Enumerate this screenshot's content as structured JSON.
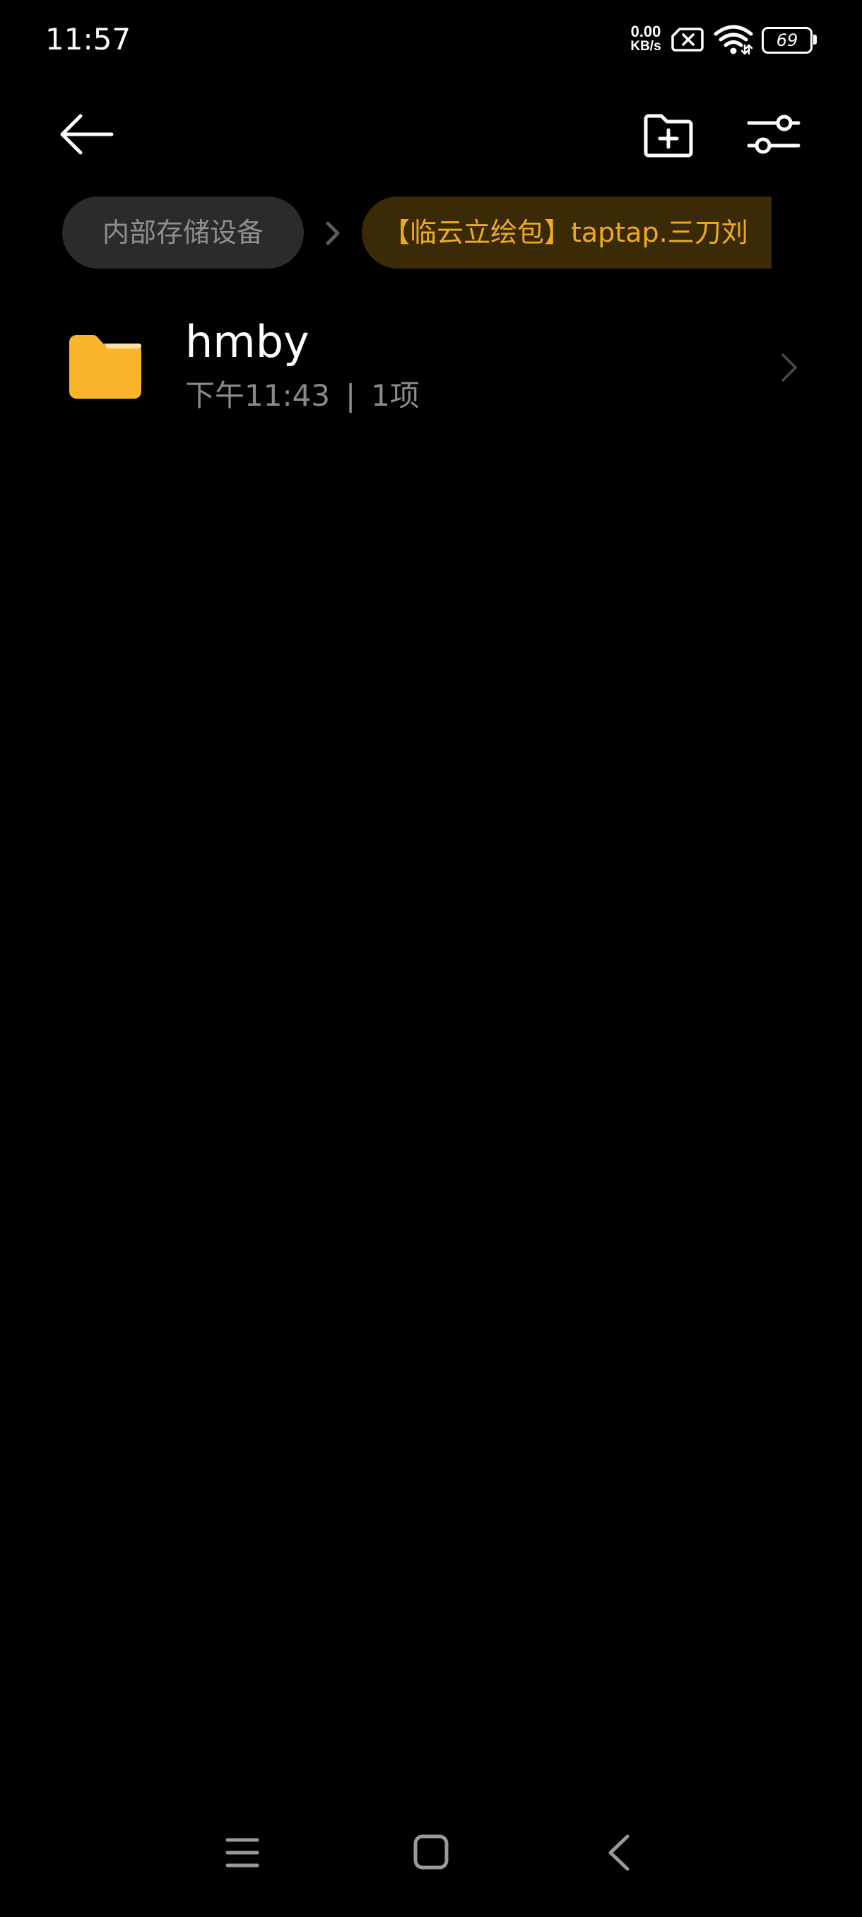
{
  "status_bar": {
    "time": "11:57",
    "net_speed_value": "0.00",
    "net_speed_unit": "KB/s",
    "battery_level": "69",
    "icons": [
      "sim-no-signal-icon",
      "wifi-icon",
      "battery-icon"
    ]
  },
  "toolbar": {
    "icons": [
      "back-arrow-icon",
      "new-folder-icon",
      "filter-sliders-icon"
    ]
  },
  "breadcrumb": {
    "root_label": "内部存储设备",
    "current_label": "【临云立绘包】taptap.三刀刘"
  },
  "file_list": {
    "items": [
      {
        "name": "hmby",
        "time": "下午11:43",
        "separator": "|",
        "count": "1项",
        "icon": "folder-icon"
      }
    ]
  },
  "nav_bar": {
    "icons": [
      "menu-icon",
      "home-icon",
      "back-icon"
    ]
  },
  "colors": {
    "background": "#000000",
    "accent": "#eeab21",
    "folder": "#fbb52a",
    "secondary_text": "#8a8a8a"
  }
}
